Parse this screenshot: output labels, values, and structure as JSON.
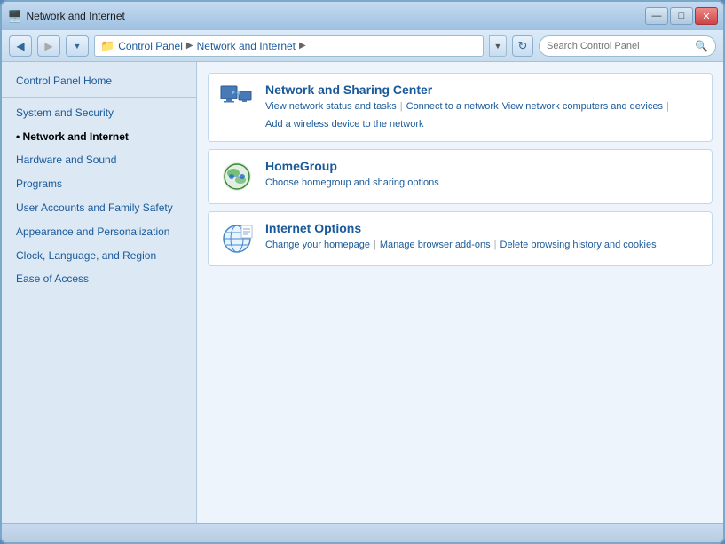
{
  "window": {
    "title": "Network and Internet",
    "titlebar_icon": "📁"
  },
  "titlebar": {
    "minimize_label": "—",
    "maximize_label": "□",
    "close_label": "✕"
  },
  "addressbar": {
    "back_icon": "◀",
    "forward_icon": "▶",
    "dropdown_icon": "▼",
    "refresh_icon": "↻",
    "breadcrumb": [
      {
        "label": "Control Panel",
        "id": "control-panel"
      },
      {
        "label": "Network and Internet",
        "id": "network-internet"
      }
    ],
    "search_placeholder": "Search Control Panel",
    "search_icon": "🔍"
  },
  "sidebar": {
    "items": [
      {
        "label": "Control Panel Home",
        "id": "control-panel-home",
        "active": false
      },
      {
        "divider": true
      },
      {
        "label": "System and Security",
        "id": "system-security",
        "active": false
      },
      {
        "label": "Network and Internet",
        "id": "network-internet",
        "active": true
      },
      {
        "label": "Hardware and Sound",
        "id": "hardware-sound",
        "active": false
      },
      {
        "label": "Programs",
        "id": "programs",
        "active": false
      },
      {
        "label": "User Accounts and Family Safety",
        "id": "user-accounts",
        "active": false
      },
      {
        "label": "Appearance and Personalization",
        "id": "appearance",
        "active": false
      },
      {
        "label": "Clock, Language, and Region",
        "id": "clock-language",
        "active": false
      },
      {
        "label": "Ease of Access",
        "id": "ease-access",
        "active": false
      }
    ]
  },
  "categories": [
    {
      "id": "network-sharing",
      "title": "Network and Sharing Center",
      "links": [
        {
          "label": "View network status and tasks",
          "id": "view-network-status"
        },
        {
          "label": "Connect to a network",
          "id": "connect-network"
        },
        {
          "label": "View network computers and devices",
          "id": "view-computers"
        },
        {
          "label": "Add a wireless device to the network",
          "id": "add-wireless"
        }
      ],
      "icon_type": "network"
    },
    {
      "id": "homegroup",
      "title": "HomeGroup",
      "links": [
        {
          "label": "Choose homegroup and sharing options",
          "id": "homegroup-options"
        }
      ],
      "icon_type": "homegroup"
    },
    {
      "id": "internet-options",
      "title": "Internet Options",
      "links": [
        {
          "label": "Change your homepage",
          "id": "change-homepage"
        },
        {
          "label": "Manage browser add-ons",
          "id": "manage-addons"
        },
        {
          "label": "Delete browsing history and cookies",
          "id": "delete-history"
        }
      ],
      "icon_type": "internet"
    }
  ],
  "statusbar": {
    "text": ""
  }
}
